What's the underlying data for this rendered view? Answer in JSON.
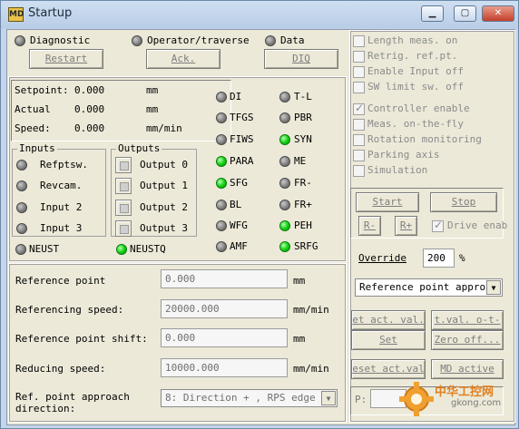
{
  "window": {
    "title": "Startup",
    "icon_text": "MD",
    "controls": [
      "minimize-icon",
      "maximize-icon",
      "close-icon"
    ]
  },
  "top": {
    "diagnostic": "Diagnostic",
    "operator": "Operator/traverse",
    "data": "Data",
    "restart": "Restart",
    "ack": "Ack.",
    "diq": "DIQ"
  },
  "values": {
    "setpoint_label": "Setpoint:",
    "setpoint_value": "0.000",
    "setpoint_unit": "mm",
    "actual_label": "Actual",
    "actual_value": "0.000",
    "actual_unit": "mm",
    "speed_label": "Speed:",
    "speed_value": "0.000",
    "speed_unit": "mm/min"
  },
  "inputs": {
    "title": "Inputs",
    "items": [
      "Refptsw.",
      "Revcam.",
      "Input 2",
      "Input 3"
    ]
  },
  "outputs": {
    "title": "Outputs",
    "items": [
      "Output 0",
      "Output 1",
      "Output 2",
      "Output 3"
    ]
  },
  "neust": "NEUST",
  "neustq": "NEUSTQ",
  "status_left": [
    "DI",
    "TFGS",
    "FIWS",
    "PARA",
    "SFG",
    "BL",
    "WFG",
    "AMF"
  ],
  "status_right": [
    "T-L",
    "PBR",
    "SYN",
    "ME",
    "FR-",
    "FR+",
    "PEH",
    "SRFG"
  ],
  "status_left_on": [
    false,
    false,
    false,
    true,
    true,
    false,
    false,
    false
  ],
  "status_right_on": [
    false,
    false,
    true,
    false,
    false,
    false,
    true,
    true
  ],
  "checks": [
    {
      "label": "Length meas. on",
      "checked": false
    },
    {
      "label": "Retrig. ref.pt.",
      "checked": false
    },
    {
      "label": "Enable Input off",
      "checked": false
    },
    {
      "label": "SW limit sw. off",
      "checked": false
    },
    {
      "label": "Controller enable",
      "checked": true
    },
    {
      "label": "Meas. on-the-fly",
      "checked": false
    },
    {
      "label": "Rotation monitoring",
      "checked": false
    },
    {
      "label": "Parking axis",
      "checked": false
    },
    {
      "label": "Simulation",
      "checked": false
    }
  ],
  "jog": {
    "start": "Start",
    "stop": "Stop",
    "rminus": "R-",
    "rplus": "R+",
    "drive": "Drive enab"
  },
  "override": {
    "label": "Override",
    "value": "200",
    "unit": "%"
  },
  "mode_select": "Reference point approa",
  "right_buttons": [
    "et act. val.",
    "t.val. o-t-f",
    "Set ref.pt...",
    "Zero off...",
    "eset act.val",
    "MD active"
  ],
  "p_label": "P:",
  "form": {
    "ref_point_label": "Reference point",
    "ref_point_value": "0.000",
    "ref_point_unit": "mm",
    "ref_speed_label": "Referencing speed:",
    "ref_speed_value": "20000.000",
    "ref_speed_unit": "mm/min",
    "shift_label": "Reference point shift:",
    "shift_value": "0.000",
    "shift_unit": "mm",
    "reducing_label": "Reducing speed:",
    "reducing_value": "10000.000",
    "reducing_unit": "mm/min",
    "approach_label": "Ref. point approach direction:",
    "approach_value": "8: Direction + , RPS edge"
  },
  "watermark": {
    "text_cn": "中华工控网",
    "text_url": "gkong.com"
  },
  "colors": {
    "led_on": "#14d414",
    "led_off": "#7b7b7b",
    "face": "#ece9d8",
    "title_bg": "#c6d6ea"
  }
}
